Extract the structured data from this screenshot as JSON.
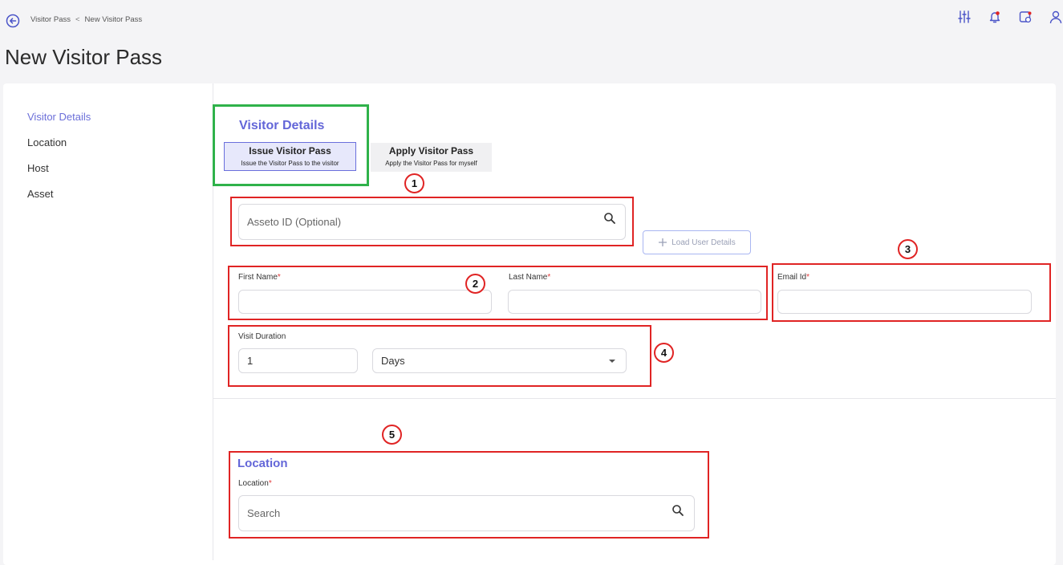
{
  "breadcrumb": {
    "parent": "Visitor Pass",
    "separator": "<",
    "current": "New Visitor Pass"
  },
  "page_title": "New Visitor Pass",
  "toolbar_icons": [
    "sliders-icon",
    "bell-icon",
    "calendar-icon",
    "user-icon"
  ],
  "sidebar": {
    "items": [
      {
        "label": "Visitor Details",
        "active": true
      },
      {
        "label": "Location",
        "active": false
      },
      {
        "label": "Host",
        "active": false
      },
      {
        "label": "Asset",
        "active": false
      }
    ]
  },
  "visitor_details": {
    "title": "Visitor Details",
    "issue_option": {
      "title": "Issue Visitor Pass",
      "subtitle": "Issue the Visitor Pass to the visitor",
      "selected": true
    },
    "apply_option": {
      "title": "Apply Visitor Pass",
      "subtitle": "Apply the Visitor Pass for myself",
      "selected": false
    },
    "asseto_search": {
      "placeholder": "Asseto ID (Optional)"
    },
    "load_button": {
      "label": "Load User Details"
    },
    "first_name": {
      "label": "First Name",
      "required": "*",
      "value": ""
    },
    "last_name": {
      "label": "Last Name",
      "required": "*",
      "value": ""
    },
    "email": {
      "label": "Email Id",
      "required": "*",
      "value": ""
    },
    "visit_duration": {
      "label": "Visit Duration",
      "value": "1",
      "unit": "Days"
    }
  },
  "location": {
    "title": "Location",
    "field_label": "Location",
    "required": "*",
    "search_placeholder": "Search"
  },
  "annotations": [
    "1",
    "2",
    "3",
    "4",
    "5"
  ],
  "colors": {
    "accent": "#6366d8",
    "annotation_red": "#e02424",
    "annotation_green": "#2fb24a",
    "required": "#e23b3b"
  }
}
